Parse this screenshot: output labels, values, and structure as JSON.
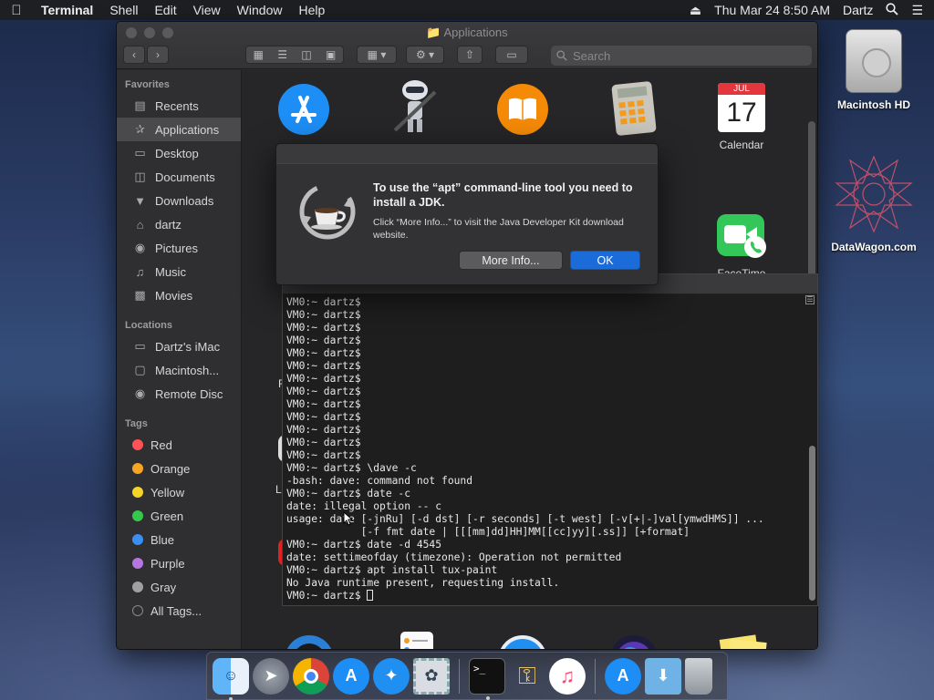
{
  "menubar": {
    "app_name": "Terminal",
    "items": [
      "Shell",
      "Edit",
      "View",
      "Window",
      "Help"
    ],
    "datetime": "Thu Mar 24  8:50 AM",
    "user": "Dartz"
  },
  "desktop": {
    "icons": [
      {
        "label": "Macintosh HD"
      },
      {
        "label": "DataWagon.com"
      }
    ]
  },
  "finder": {
    "title": "Applications",
    "search_placeholder": "Search",
    "sidebar": {
      "favorites_heading": "Favorites",
      "favorites": [
        "Recents",
        "Applications",
        "Desktop",
        "Documents",
        "Downloads",
        "dartz",
        "Pictures",
        "Music",
        "Movies"
      ],
      "locations_heading": "Locations",
      "locations": [
        "Dartz's iMac",
        "Macintosh...",
        "Remote Disc"
      ],
      "tags_heading": "Tags",
      "tags": [
        {
          "name": "Red",
          "color": "#ff5257"
        },
        {
          "name": "Orange",
          "color": "#f6a623"
        },
        {
          "name": "Yellow",
          "color": "#f5d328"
        },
        {
          "name": "Green",
          "color": "#36c84b"
        },
        {
          "name": "Blue",
          "color": "#3b8ff2"
        },
        {
          "name": "Purple",
          "color": "#b775e0"
        },
        {
          "name": "Gray",
          "color": "#a0a0a2"
        }
      ],
      "all_tags": "All Tags..."
    },
    "apps": {
      "calendar": {
        "label": "Calendar",
        "month": "JUL",
        "day": "17"
      },
      "facetime": {
        "label": "FaceTime"
      },
      "hidden_partial": [
        "F",
        "L"
      ]
    }
  },
  "dialog": {
    "title": "To use the “apt” command-line tool you need to install a JDK.",
    "message": "Click “More Info...” to visit the Java Developer Kit download website.",
    "secondary_button": "More Info...",
    "primary_button": "OK"
  },
  "terminal": {
    "lines": [
      "VM0:~ dartz$",
      "VM0:~ dartz$",
      "VM0:~ dartz$",
      "VM0:~ dartz$",
      "VM0:~ dartz$",
      "VM0:~ dartz$",
      "VM0:~ dartz$",
      "VM0:~ dartz$",
      "VM0:~ dartz$",
      "VM0:~ dartz$",
      "VM0:~ dartz$",
      "VM0:~ dartz$",
      "VM0:~ dartz$",
      "VM0:~ dartz$ \\dave -c",
      "-bash: dave: command not found",
      "VM0:~ dartz$ date -c",
      "date: illegal option -- c",
      "usage: date [-jnRu] [-d dst] [-r seconds] [-t west] [-v[+|-]val[ymwdHMS]] ...",
      "            [-f fmt date | [[[mm]dd]HH]MM[[cc]yy][.ss]] [+format]",
      "VM0:~ dartz$ date -d 4545",
      "date: settimeofday (timezone): Operation not permitted",
      "VM0:~ dartz$ apt install tux-paint",
      "No Java runtime present, requesting install.",
      "VM0:~ dartz$ "
    ]
  },
  "dock": {
    "items": [
      "finder-icon",
      "launchpad-icon",
      "chrome-icon",
      "app-store-icon",
      "safari-icon",
      "mail-stamp-icon",
      "terminal-icon",
      "keychain-icon",
      "music-icon",
      "app-store-icon",
      "downloads-folder-icon",
      "trash-icon"
    ]
  }
}
